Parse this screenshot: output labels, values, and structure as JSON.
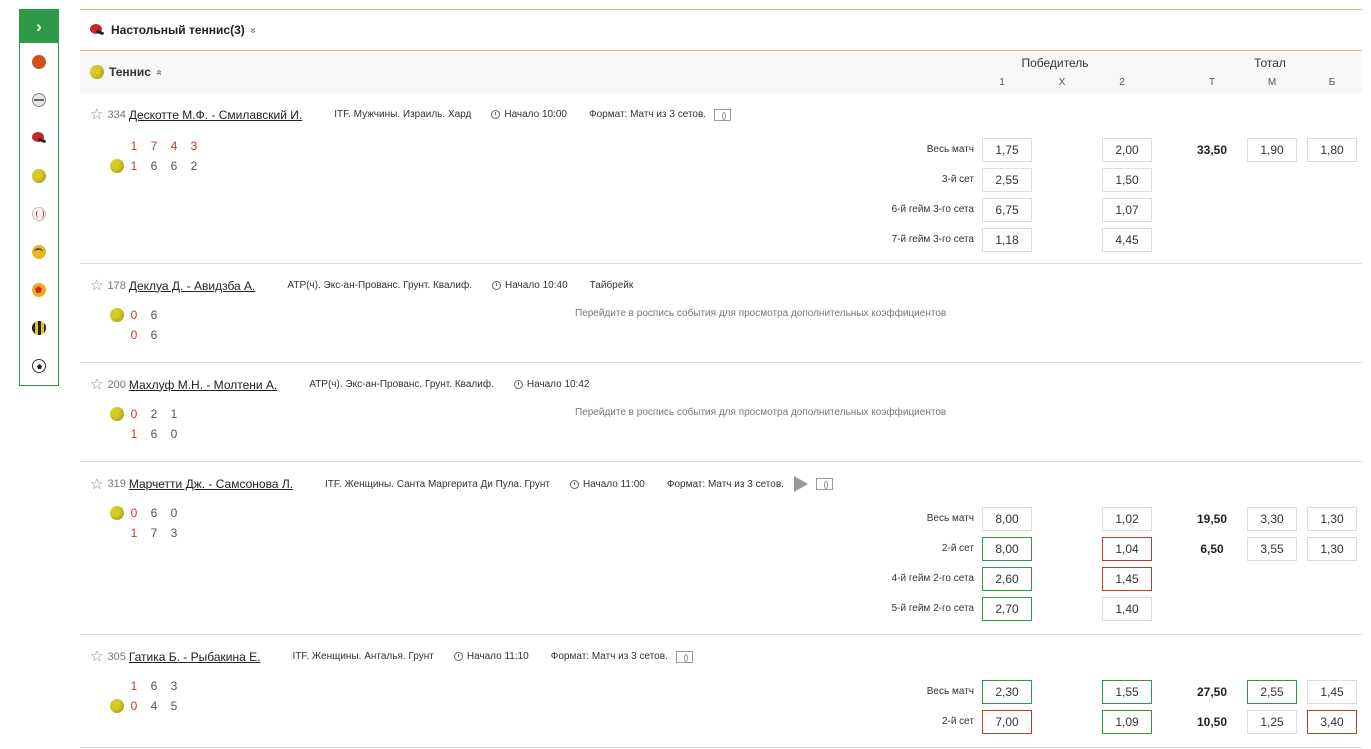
{
  "sidebar": {
    "toggle_glyph": "›",
    "icons": [
      "basketball-icon",
      "hockey-icon",
      "table-tennis-icon",
      "tennis-icon",
      "baseball-icon",
      "volleyball-icon",
      "handball-icon",
      "stripe-ball-icon",
      "soccer-icon"
    ]
  },
  "sport_header": {
    "title": "Настольный теннис(3)",
    "chevron": "»"
  },
  "tennis_header": {
    "title": "Теннис",
    "chevron": "»",
    "winner_label": "Победитель",
    "total_label": "Тотал",
    "cols": {
      "c1": "1",
      "cx": "X",
      "c2": "2",
      "ct": "T",
      "cm": "М",
      "cb": "Б"
    }
  },
  "colors": {
    "accent_green": "#2e9a47",
    "down_red": "#c0392b",
    "header_border": "#e2b98d"
  },
  "events": [
    {
      "num": "334",
      "name": "Дескотте М.Ф. - Смилавский И.",
      "league": "ITF. Мужчины. Израиль. Хард",
      "start": "Начало 10:00",
      "format": "Формат: Матч из 3 сетов.",
      "scores": [
        [
          "1",
          "7",
          "4",
          "3"
        ],
        [
          "1",
          "6",
          "6",
          "2"
        ]
      ],
      "bets": [
        {
          "label": "Весь матч",
          "o1": "1,75",
          "o2": "2,00",
          "t": "33,50",
          "m": "1,90",
          "b": "1,80"
        },
        {
          "label": "3-й сет",
          "o1": "2,55",
          "o2": "1,50"
        },
        {
          "label": "6-й гейм 3-го сета",
          "o1": "6,75",
          "o2": "1,07"
        },
        {
          "label": "7-й гейм 3-го сета",
          "o1": "1,18",
          "o2": "4,45"
        }
      ]
    },
    {
      "num": "178",
      "name": "Деклуа Д. - Авидзба А.",
      "league": "ATP(ч). Экс-ан-Прованс. Грунт. Квалиф.",
      "start": "Начало 10:40",
      "format": "Тайбрейк",
      "scores": [
        [
          "0",
          "6"
        ],
        [
          "0",
          "6"
        ]
      ],
      "note": "Перейдите в роспись события для просмотра дополнительных коэффициентов"
    },
    {
      "num": "200",
      "name": "Махлуф М.Н. - Молтени А.",
      "league": "ATP(ч). Экс-ан-Прованс. Грунт. Квалиф.",
      "start": "Начало 10:42",
      "scores": [
        [
          "0",
          "2",
          "1"
        ],
        [
          "1",
          "6",
          "0"
        ]
      ],
      "note": "Перейдите в роспись события для просмотра дополнительных коэффициентов"
    },
    {
      "num": "319",
      "name": "Марчетти Дж. - Самсонова Л.",
      "league": "ITF. Женщины. Санта Маргерита Ди Пула. Грунт",
      "start": "Начало 11:00",
      "format": "Формат: Матч из 3 сетов.",
      "scores": [
        [
          "0",
          "6",
          "0"
        ],
        [
          "1",
          "7",
          "3"
        ]
      ],
      "bets": [
        {
          "label": "Весь матч",
          "o1": "8,00",
          "o2": "1,02",
          "t": "19,50",
          "m": "3,30",
          "b": "1,30"
        },
        {
          "label": "2-й сет",
          "o1": "8,00",
          "o2": "1,04",
          "t": "6,50",
          "m": "3,55",
          "b": "1,30"
        },
        {
          "label": "4-й гейм 2-го сета",
          "o1": "2,60",
          "o2": "1,45"
        },
        {
          "label": "5-й гейм 2-го сета",
          "o1": "2,70",
          "o2": "1,40"
        }
      ]
    },
    {
      "num": "305",
      "name": "Гатика Б. - Рыбакина Е.",
      "league": "ITF. Женщины. Анталья. Грунт",
      "start": "Начало 11:10",
      "format": "Формат: Матч из 3 сетов.",
      "scores": [
        [
          "1",
          "6",
          "3"
        ],
        [
          "0",
          "4",
          "5"
        ]
      ],
      "bets": [
        {
          "label": "Весь матч",
          "o1": "2,30",
          "o2": "1,55",
          "t": "27,50",
          "m": "2,55",
          "b": "1,45"
        },
        {
          "label": "2-й сет",
          "o1": "7,00",
          "o2": "1,09",
          "t": "10,50",
          "m": "1,25",
          "b": "3,40"
        }
      ]
    }
  ]
}
